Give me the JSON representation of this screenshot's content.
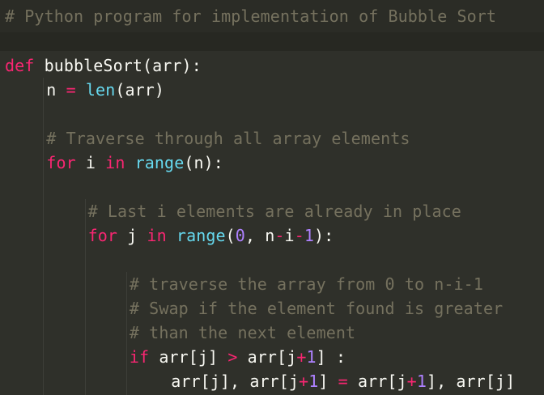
{
  "editor": {
    "header_comment": "# Python program for implementation of Bubble Sort",
    "lines": [
      {
        "indent": 0,
        "tokens": [
          {
            "t": "def",
            "k": "kw"
          },
          {
            "t": " bubbleSort(arr):",
            "k": "tx"
          }
        ]
      },
      {
        "indent": 1,
        "tokens": [
          {
            "t": "n ",
            "k": "tx"
          },
          {
            "t": "=",
            "k": "op"
          },
          {
            "t": " ",
            "k": "tx"
          },
          {
            "t": "len",
            "k": "bi"
          },
          {
            "t": "(arr)",
            "k": "tx"
          }
        ]
      },
      {
        "indent": 0,
        "tokens": []
      },
      {
        "indent": 1,
        "tokens": [
          {
            "t": "# Traverse through all array elements",
            "k": "cm"
          }
        ]
      },
      {
        "indent": 1,
        "tokens": [
          {
            "t": "for",
            "k": "kw"
          },
          {
            "t": " i ",
            "k": "tx"
          },
          {
            "t": "in",
            "k": "kw"
          },
          {
            "t": " ",
            "k": "tx"
          },
          {
            "t": "range",
            "k": "bi"
          },
          {
            "t": "(n):",
            "k": "tx"
          }
        ]
      },
      {
        "indent": 0,
        "tokens": []
      },
      {
        "indent": 2,
        "tokens": [
          {
            "t": "# Last i elements are already in place",
            "k": "cm"
          }
        ]
      },
      {
        "indent": 2,
        "tokens": [
          {
            "t": "for",
            "k": "kw"
          },
          {
            "t": " j ",
            "k": "tx"
          },
          {
            "t": "in",
            "k": "kw"
          },
          {
            "t": " ",
            "k": "tx"
          },
          {
            "t": "range",
            "k": "bi"
          },
          {
            "t": "(",
            "k": "tx"
          },
          {
            "t": "0",
            "k": "nm"
          },
          {
            "t": ", n",
            "k": "tx"
          },
          {
            "t": "-",
            "k": "op"
          },
          {
            "t": "i",
            "k": "tx"
          },
          {
            "t": "-",
            "k": "op"
          },
          {
            "t": "1",
            "k": "nm"
          },
          {
            "t": "):",
            "k": "tx"
          }
        ]
      },
      {
        "indent": 0,
        "tokens": []
      },
      {
        "indent": 3,
        "tokens": [
          {
            "t": "# traverse the array from 0 to n-i-1",
            "k": "cm"
          }
        ]
      },
      {
        "indent": 3,
        "tokens": [
          {
            "t": "# Swap if the element found is greater",
            "k": "cm"
          }
        ]
      },
      {
        "indent": 3,
        "tokens": [
          {
            "t": "# than the next element",
            "k": "cm"
          }
        ]
      },
      {
        "indent": 3,
        "tokens": [
          {
            "t": "if",
            "k": "kw"
          },
          {
            "t": " arr[j] ",
            "k": "tx"
          },
          {
            "t": ">",
            "k": "op"
          },
          {
            "t": " arr[j",
            "k": "tx"
          },
          {
            "t": "+",
            "k": "op"
          },
          {
            "t": "1",
            "k": "nm"
          },
          {
            "t": "] :",
            "k": "tx"
          }
        ]
      },
      {
        "indent": 4,
        "tokens": [
          {
            "t": "arr[j], arr[j",
            "k": "tx"
          },
          {
            "t": "+",
            "k": "op"
          },
          {
            "t": "1",
            "k": "nm"
          },
          {
            "t": "] ",
            "k": "tx"
          },
          {
            "t": "=",
            "k": "op"
          },
          {
            "t": " arr[j",
            "k": "tx"
          },
          {
            "t": "+",
            "k": "op"
          },
          {
            "t": "1",
            "k": "nm"
          },
          {
            "t": "], arr[j]",
            "k": "tx"
          }
        ]
      }
    ]
  },
  "colors": {
    "background": "#272822",
    "panel": "#2f302a",
    "comment": "#75715e",
    "keyword": "#f92672",
    "builtin": "#66d9ef",
    "number": "#ae81ff",
    "text": "#f8f8f2"
  }
}
